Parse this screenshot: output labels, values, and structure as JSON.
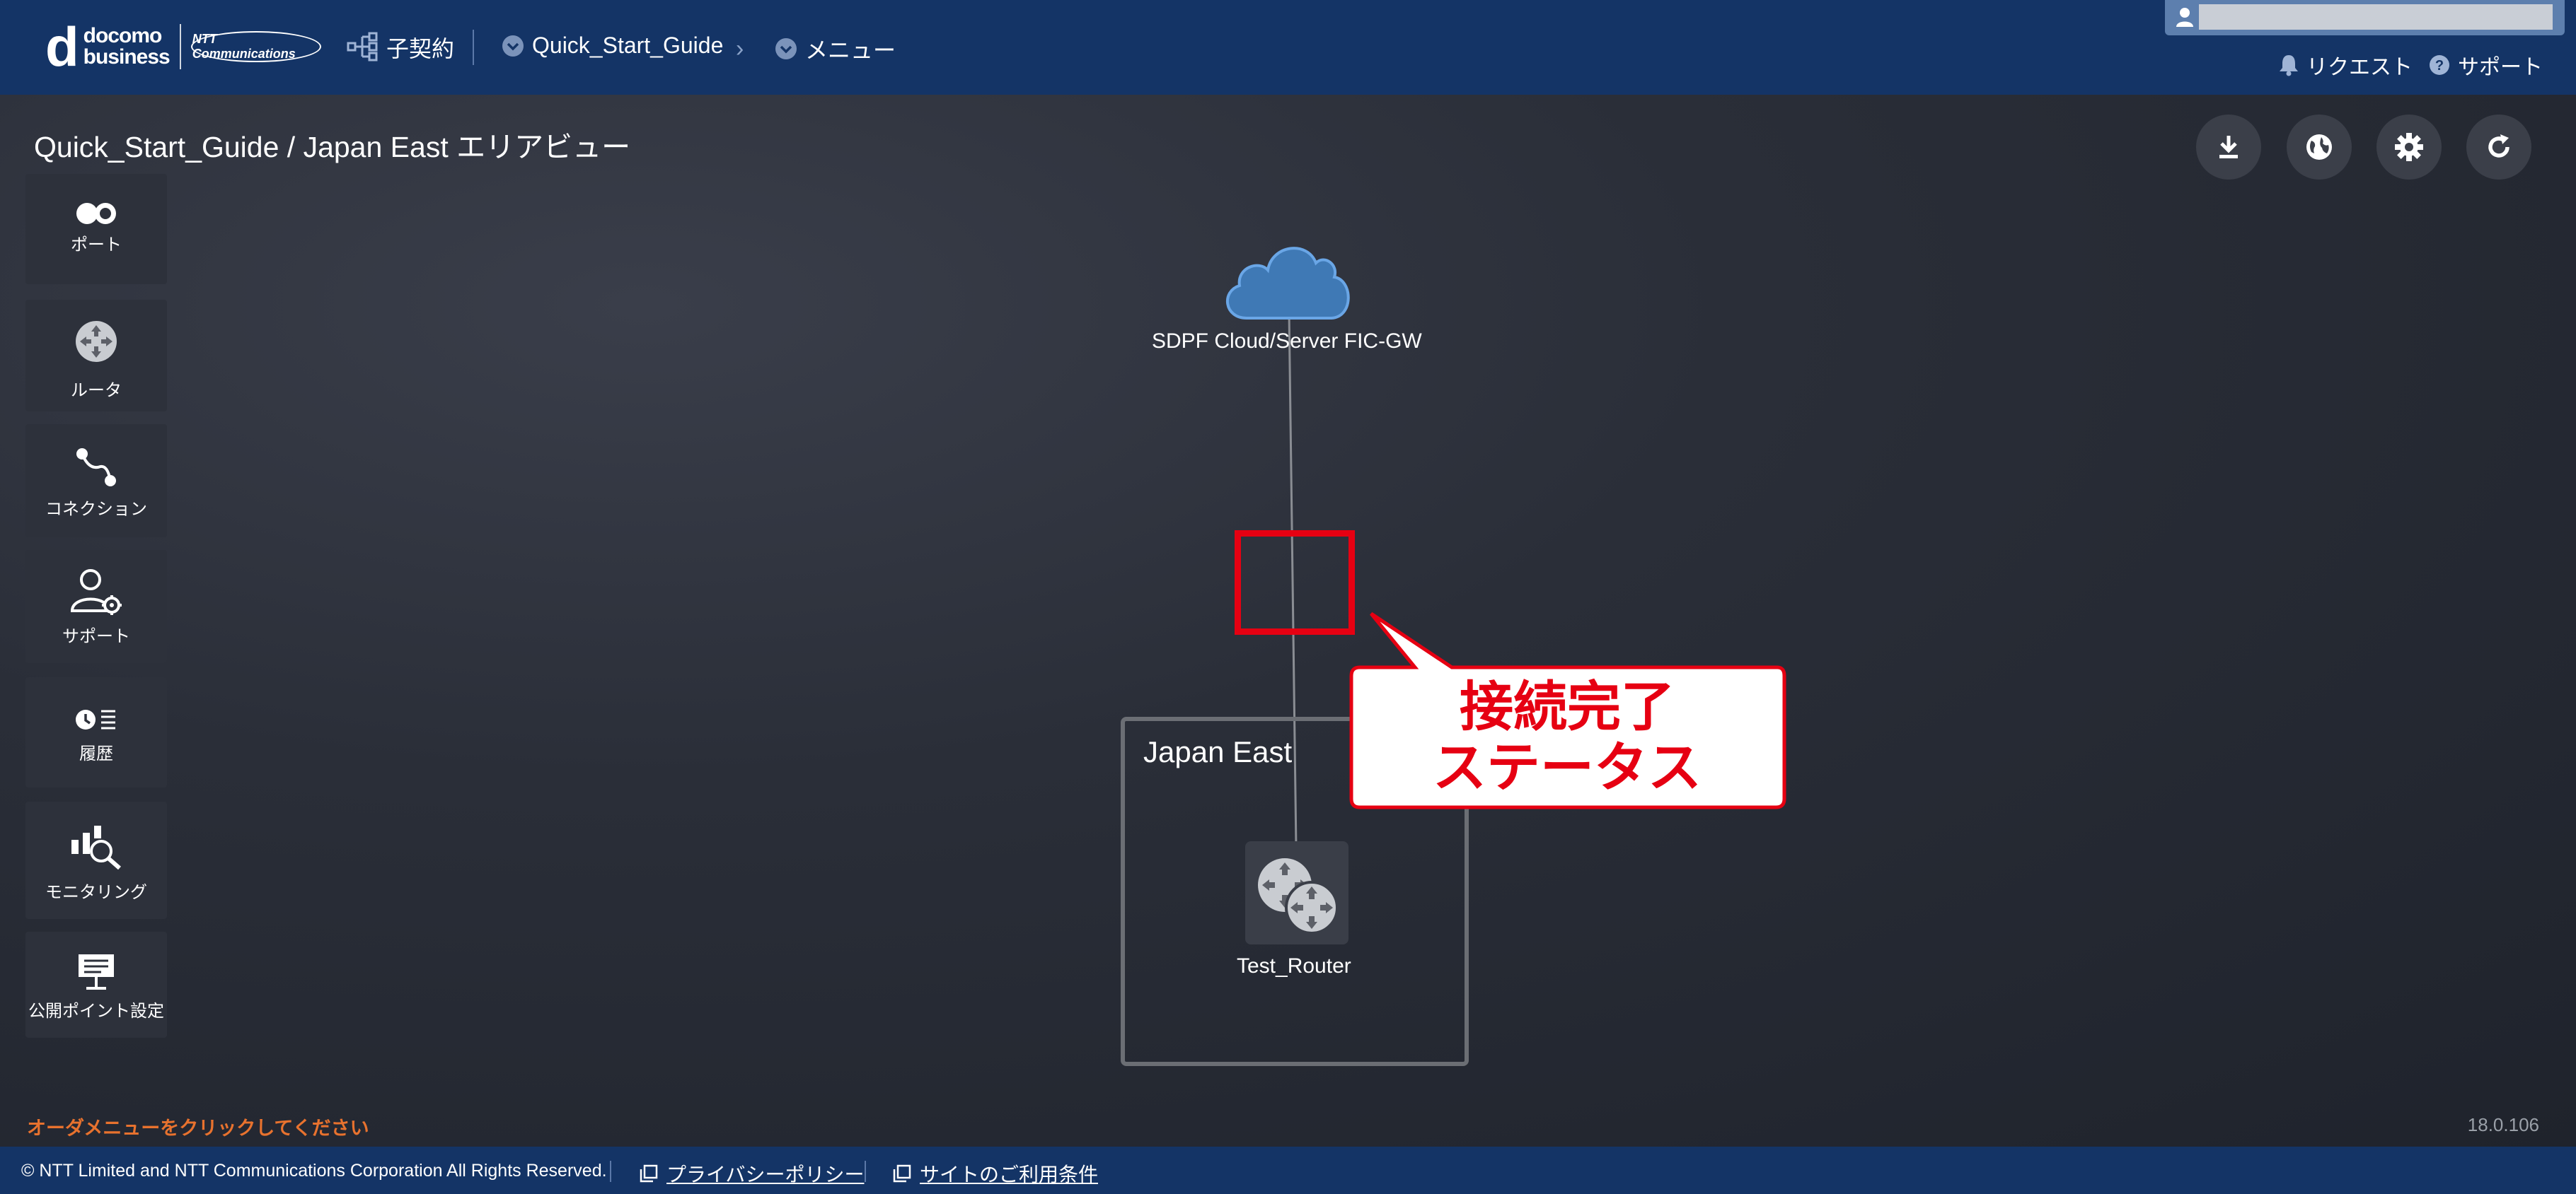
{
  "header": {
    "logo": {
      "mark": "d",
      "line1": "docomo",
      "line2": "business",
      "ntt": "NTT Communications"
    },
    "contract_label": "子契約",
    "breadcrumb": [
      "Quick_Start_Guide",
      "メニュー"
    ],
    "request_label": "リクエスト",
    "support_label": "サポート"
  },
  "page": {
    "title": "Quick_Start_Guide / Japan East エリアビュー"
  },
  "toolbar": {
    "icons": [
      "download-icon",
      "globe-icon",
      "gear-icon",
      "refresh-icon"
    ]
  },
  "sidebar": {
    "items": [
      {
        "label": "ポート",
        "icon": "port-icon"
      },
      {
        "label": "ルータ",
        "icon": "router-icon"
      },
      {
        "label": "コネクション",
        "icon": "connection-icon"
      },
      {
        "label": "サポート",
        "icon": "support-user-icon"
      },
      {
        "label": "履歴",
        "icon": "history-icon"
      },
      {
        "label": "モニタリング",
        "icon": "monitoring-icon"
      },
      {
        "label": "公開ポイント設定",
        "icon": "public-point-icon"
      }
    ]
  },
  "diagram": {
    "cloud_label": "SDPF Cloud/Server FIC-GW",
    "area_label": "Japan East",
    "router_label": "Test_Router",
    "callout": {
      "line1": "接続完了",
      "line2": "ステータス"
    },
    "colors": {
      "cloud": "#3f79b5",
      "annotation": "#e60012",
      "line": "#8a8d93"
    }
  },
  "status": {
    "order_hint": "オーダメニューをクリックしてください",
    "version": "18.0.106"
  },
  "footer": {
    "copyright": "© NTT Limited and NTT Communications Corporation All Rights Reserved.",
    "privacy_link": "プライバシーポリシー",
    "terms_link": "サイトのご利用条件"
  }
}
